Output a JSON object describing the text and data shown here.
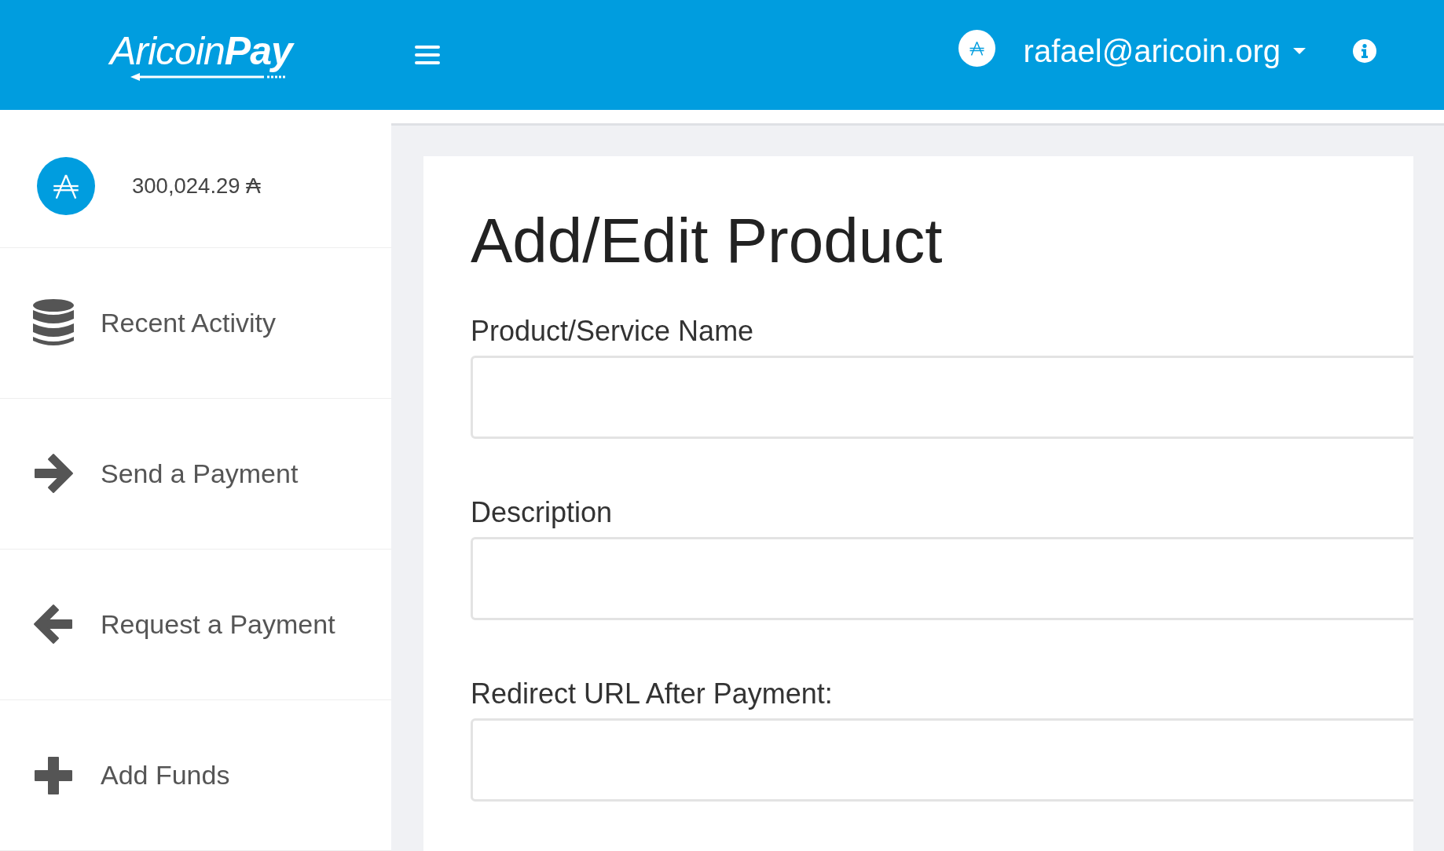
{
  "header": {
    "logo": "Aricoin**Pay**",
    "user_email": "rafael@aricoin.org"
  },
  "sidebar": {
    "balance": "300,024.29 ₳",
    "items": [
      {
        "label": "Recent Activity",
        "kind": "database"
      },
      {
        "label": "Send a Payment",
        "kind": "forward"
      },
      {
        "label": "Request a Payment",
        "kind": "back"
      },
      {
        "label": "Add Funds",
        "kind": "plus"
      }
    ]
  },
  "form": {
    "title": "Add/Edit Product",
    "fields": [
      {
        "label": "Product/Service Name"
      },
      {
        "label": "Description"
      },
      {
        "label": "Redirect URL After Payment:"
      }
    ]
  }
}
